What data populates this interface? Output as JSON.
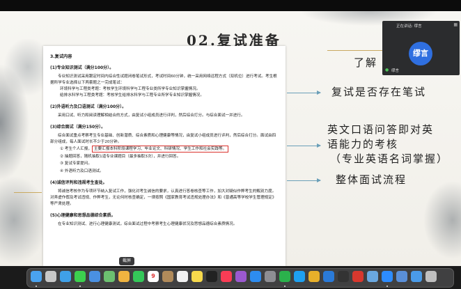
{
  "slide": {
    "title": "02.复试准备",
    "doc": {
      "section": "3.复试内容",
      "s1_title": "(1)专业知识测试（满分100分）。",
      "s1_p1": "专业知识测试采用跟定时间内综合性试题闭卷笔试形式，考试时间60分钟，统一采用网络远程方式（双机位）进行考试。考生根据所学专业选择以下两套题之一完成笔试：",
      "s1_p2": "环境科学与工程类考题：考核学生环境科学与工程专业类所学专业知识掌握情况。",
      "s1_p3": "给排水科学与工程类考题：考核学生给排水科学与工程专业所学专业知识掌握情况。",
      "s2_title": "(2)外语听力及口语测试（满分100分）。",
      "s2_p1": "采用口试、听力和阅读理解相结合的方式，由复试小组成员进行评判，然后综合打分。与综合面试一并进行。",
      "s3_title": "(3)综合面试（满分150分）。",
      "s3_p1": "综合面试重点考察考生专业基础、创新潜质、综合素质和心理健康等情况，由复试小组成员进行评判，然后综合打分。面试由四部分组成，每人面试时长不少于20分钟。",
      "items": [
        "① 考生个人汇报，",
        "② 抽题回答，随机抽取1道专业课题目（最多抽取3次），并进行回答。",
        "③ 复试专家提问。",
        "④ 外语听力及口语测试。"
      ],
      "item1_highlight": "主要汇报本科阶段课程学习、毕业论文、科研情况、学生工作和社会实践等。",
      "s4_title": "(4)诚信评判和违规考生查处。",
      "s4_p1": "将诚信考核作为专项环节纳入复试工作，强化对考生诚信的要求，认真进行答卷核查等工作，加大对疑似作弊考生的甄别力度。对弄虚作假及考试违规、作弊考生，无论何时核查确定，一律按照《国家教育考试违规处理办法》和《普通高等学校学生管理规定》等严肃处理。",
      "s5_title": "(5)心理健康和思想品德综合素质。",
      "s5_p1": "在专业知识测试、进行心理健康测试，综合面试过程中考察考生心理健康状况及思想品德综合素质情况。"
    },
    "notes": {
      "n0": "了解",
      "n1": "复试是否存在笔试",
      "n2a": "英文口语问答即对英",
      "n2b": "语能力的考核",
      "n2c": "（专业英语名词掌握）",
      "n3": "整体面试流程"
    }
  },
  "video_call": {
    "speaking_label": "正在讲话: 缪言",
    "avatar_text": "缪言",
    "participant_name": "缪言"
  },
  "dock": {
    "tooltip": "截屏",
    "calendar_day": "9"
  },
  "colors": {
    "accent_arrow": "#6a9fb8",
    "highlight_box": "#d9302c",
    "avatar_bg": "#2f6fe0",
    "gold_rule": "#c9a960"
  }
}
